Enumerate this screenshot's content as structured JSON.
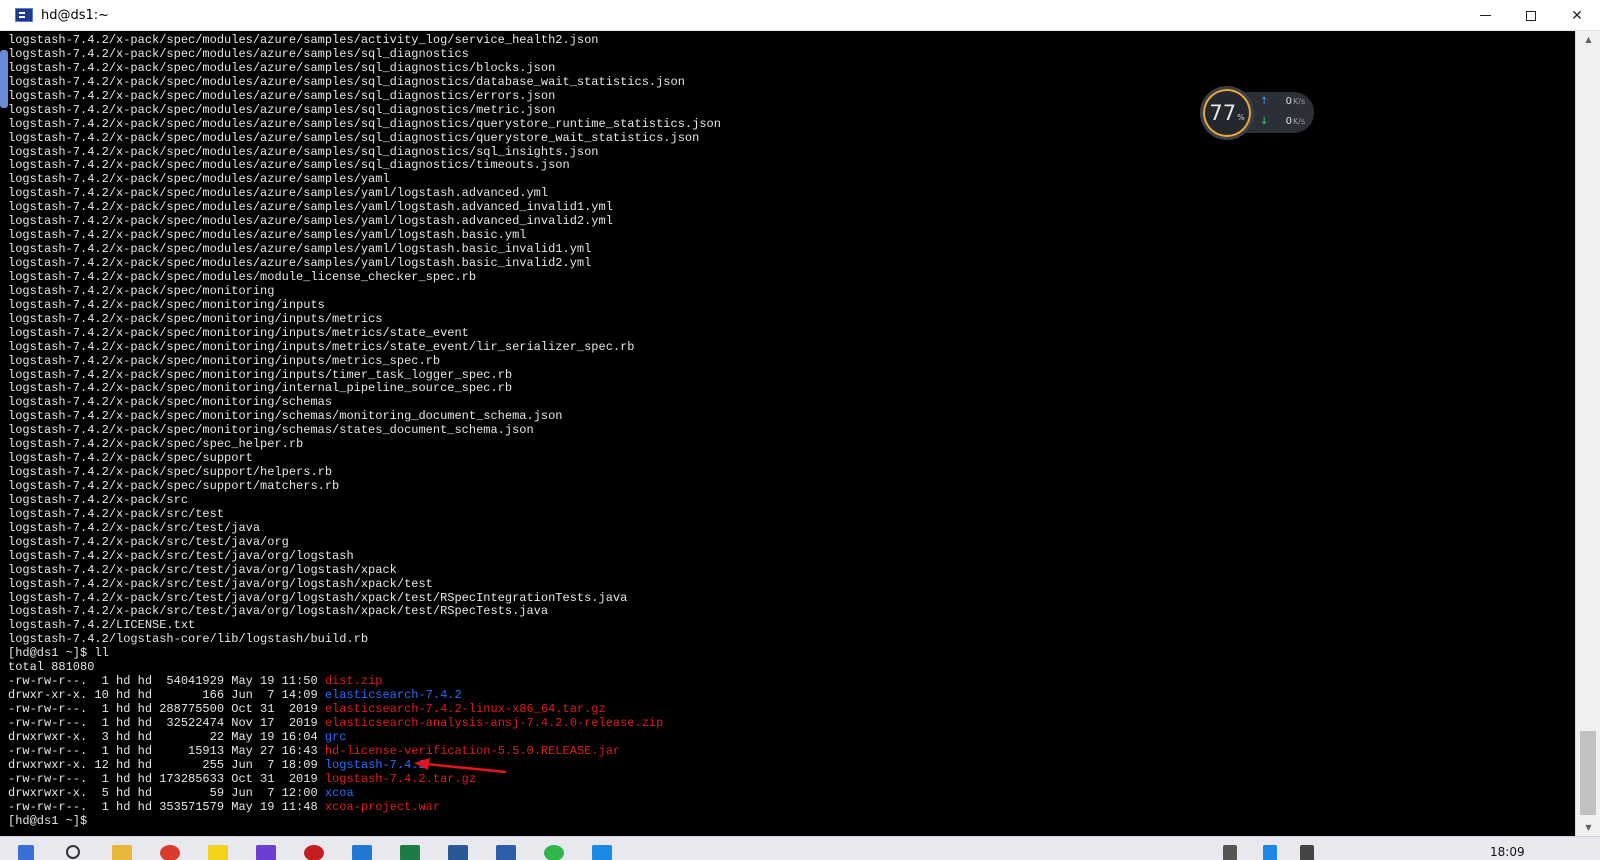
{
  "window": {
    "title": "hd@ds1:~",
    "minimize_icon": "minimize-icon",
    "maximize_icon": "maximize-icon",
    "close_label": "✕"
  },
  "terminal": {
    "find_lines": [
      "logstash-7.4.2/x-pack/spec/modules/azure/samples/activity_log/service_health2.json",
      "logstash-7.4.2/x-pack/spec/modules/azure/samples/sql_diagnostics",
      "logstash-7.4.2/x-pack/spec/modules/azure/samples/sql_diagnostics/blocks.json",
      "logstash-7.4.2/x-pack/spec/modules/azure/samples/sql_diagnostics/database_wait_statistics.json",
      "logstash-7.4.2/x-pack/spec/modules/azure/samples/sql_diagnostics/errors.json",
      "logstash-7.4.2/x-pack/spec/modules/azure/samples/sql_diagnostics/metric.json",
      "logstash-7.4.2/x-pack/spec/modules/azure/samples/sql_diagnostics/querystore_runtime_statistics.json",
      "logstash-7.4.2/x-pack/spec/modules/azure/samples/sql_diagnostics/querystore_wait_statistics.json",
      "logstash-7.4.2/x-pack/spec/modules/azure/samples/sql_diagnostics/sql_insights.json",
      "logstash-7.4.2/x-pack/spec/modules/azure/samples/sql_diagnostics/timeouts.json",
      "logstash-7.4.2/x-pack/spec/modules/azure/samples/yaml",
      "logstash-7.4.2/x-pack/spec/modules/azure/samples/yaml/logstash.advanced.yml",
      "logstash-7.4.2/x-pack/spec/modules/azure/samples/yaml/logstash.advanced_invalid1.yml",
      "logstash-7.4.2/x-pack/spec/modules/azure/samples/yaml/logstash.advanced_invalid2.yml",
      "logstash-7.4.2/x-pack/spec/modules/azure/samples/yaml/logstash.basic.yml",
      "logstash-7.4.2/x-pack/spec/modules/azure/samples/yaml/logstash.basic_invalid1.yml",
      "logstash-7.4.2/x-pack/spec/modules/azure/samples/yaml/logstash.basic_invalid2.yml",
      "logstash-7.4.2/x-pack/spec/modules/module_license_checker_spec.rb",
      "logstash-7.4.2/x-pack/spec/monitoring",
      "logstash-7.4.2/x-pack/spec/monitoring/inputs",
      "logstash-7.4.2/x-pack/spec/monitoring/inputs/metrics",
      "logstash-7.4.2/x-pack/spec/monitoring/inputs/metrics/state_event",
      "logstash-7.4.2/x-pack/spec/monitoring/inputs/metrics/state_event/lir_serializer_spec.rb",
      "logstash-7.4.2/x-pack/spec/monitoring/inputs/metrics_spec.rb",
      "logstash-7.4.2/x-pack/spec/monitoring/inputs/timer_task_logger_spec.rb",
      "logstash-7.4.2/x-pack/spec/monitoring/internal_pipeline_source_spec.rb",
      "logstash-7.4.2/x-pack/spec/monitoring/schemas",
      "logstash-7.4.2/x-pack/spec/monitoring/schemas/monitoring_document_schema.json",
      "logstash-7.4.2/x-pack/spec/monitoring/schemas/states_document_schema.json",
      "logstash-7.4.2/x-pack/spec/spec_helper.rb",
      "logstash-7.4.2/x-pack/spec/support",
      "logstash-7.4.2/x-pack/spec/support/helpers.rb",
      "logstash-7.4.2/x-pack/spec/support/matchers.rb",
      "logstash-7.4.2/x-pack/src",
      "logstash-7.4.2/x-pack/src/test",
      "logstash-7.4.2/x-pack/src/test/java",
      "logstash-7.4.2/x-pack/src/test/java/org",
      "logstash-7.4.2/x-pack/src/test/java/org/logstash",
      "logstash-7.4.2/x-pack/src/test/java/org/logstash/xpack",
      "logstash-7.4.2/x-pack/src/test/java/org/logstash/xpack/test",
      "logstash-7.4.2/x-pack/src/test/java/org/logstash/xpack/test/RSpecIntegrationTests.java",
      "logstash-7.4.2/x-pack/src/test/java/org/logstash/xpack/test/RSpecTests.java",
      "logstash-7.4.2/LICENSE.txt",
      "logstash-7.4.2/logstash-core/lib/logstash/build.rb"
    ],
    "prompt_ll": "[hd@ds1 ~]$ ll",
    "total": "total 881080",
    "listing": [
      {
        "meta": "-rw-rw-r--.  1 hd hd  54041929 May 19 11:50 ",
        "name": "dist.zip",
        "color": "red"
      },
      {
        "meta": "drwxr-xr-x. 10 hd hd       166 Jun  7 14:09 ",
        "name": "elasticsearch-7.4.2",
        "color": "blue"
      },
      {
        "meta": "-rw-rw-r--.  1 hd hd 288775500 Oct 31  2019 ",
        "name": "elasticsearch-7.4.2-linux-x86_64.tar.gz",
        "color": "red"
      },
      {
        "meta": "-rw-rw-r--.  1 hd hd  32522474 Nov 17  2019 ",
        "name": "elasticsearch-analysis-ansj-7.4.2.0-release.zip",
        "color": "red"
      },
      {
        "meta": "drwxrwxr-x.  3 hd hd        22 May 19 16:04 ",
        "name": "grc",
        "color": "blue"
      },
      {
        "meta": "-rw-rw-r--.  1 hd hd     15913 May 27 16:43 ",
        "name": "hd-license-verification-5.5.0.RELEASE.jar",
        "color": "red"
      },
      {
        "meta": "drwxrwxr-x. 12 hd hd       255 Jun  7 18:09 ",
        "name": "logstash-7.4.2",
        "color": "blue"
      },
      {
        "meta": "-rw-rw-r--.  1 hd hd 173285633 Oct 31  2019 ",
        "name": "logstash-7.4.2.tar.gz",
        "color": "red"
      },
      {
        "meta": "drwxrwxr-x.  5 hd hd        59 Jun  7 12:00 ",
        "name": "xcoa",
        "color": "blue"
      },
      {
        "meta": "-rw-rw-r--.  1 hd hd 353571579 May 19 11:48 ",
        "name": "xcoa-project.war",
        "color": "red"
      }
    ],
    "prompt_end": "[hd@ds1 ~]$ "
  },
  "net_widget": {
    "percent": "77",
    "percent_sign": "%",
    "up_value": "0",
    "down_value": "0",
    "unit": "K/s"
  },
  "taskbar": {
    "clock": "18:09"
  },
  "colors": {
    "file_red": "#e01b1b",
    "dir_blue": "#2a6bff",
    "arrow_red": "#e8141b"
  }
}
